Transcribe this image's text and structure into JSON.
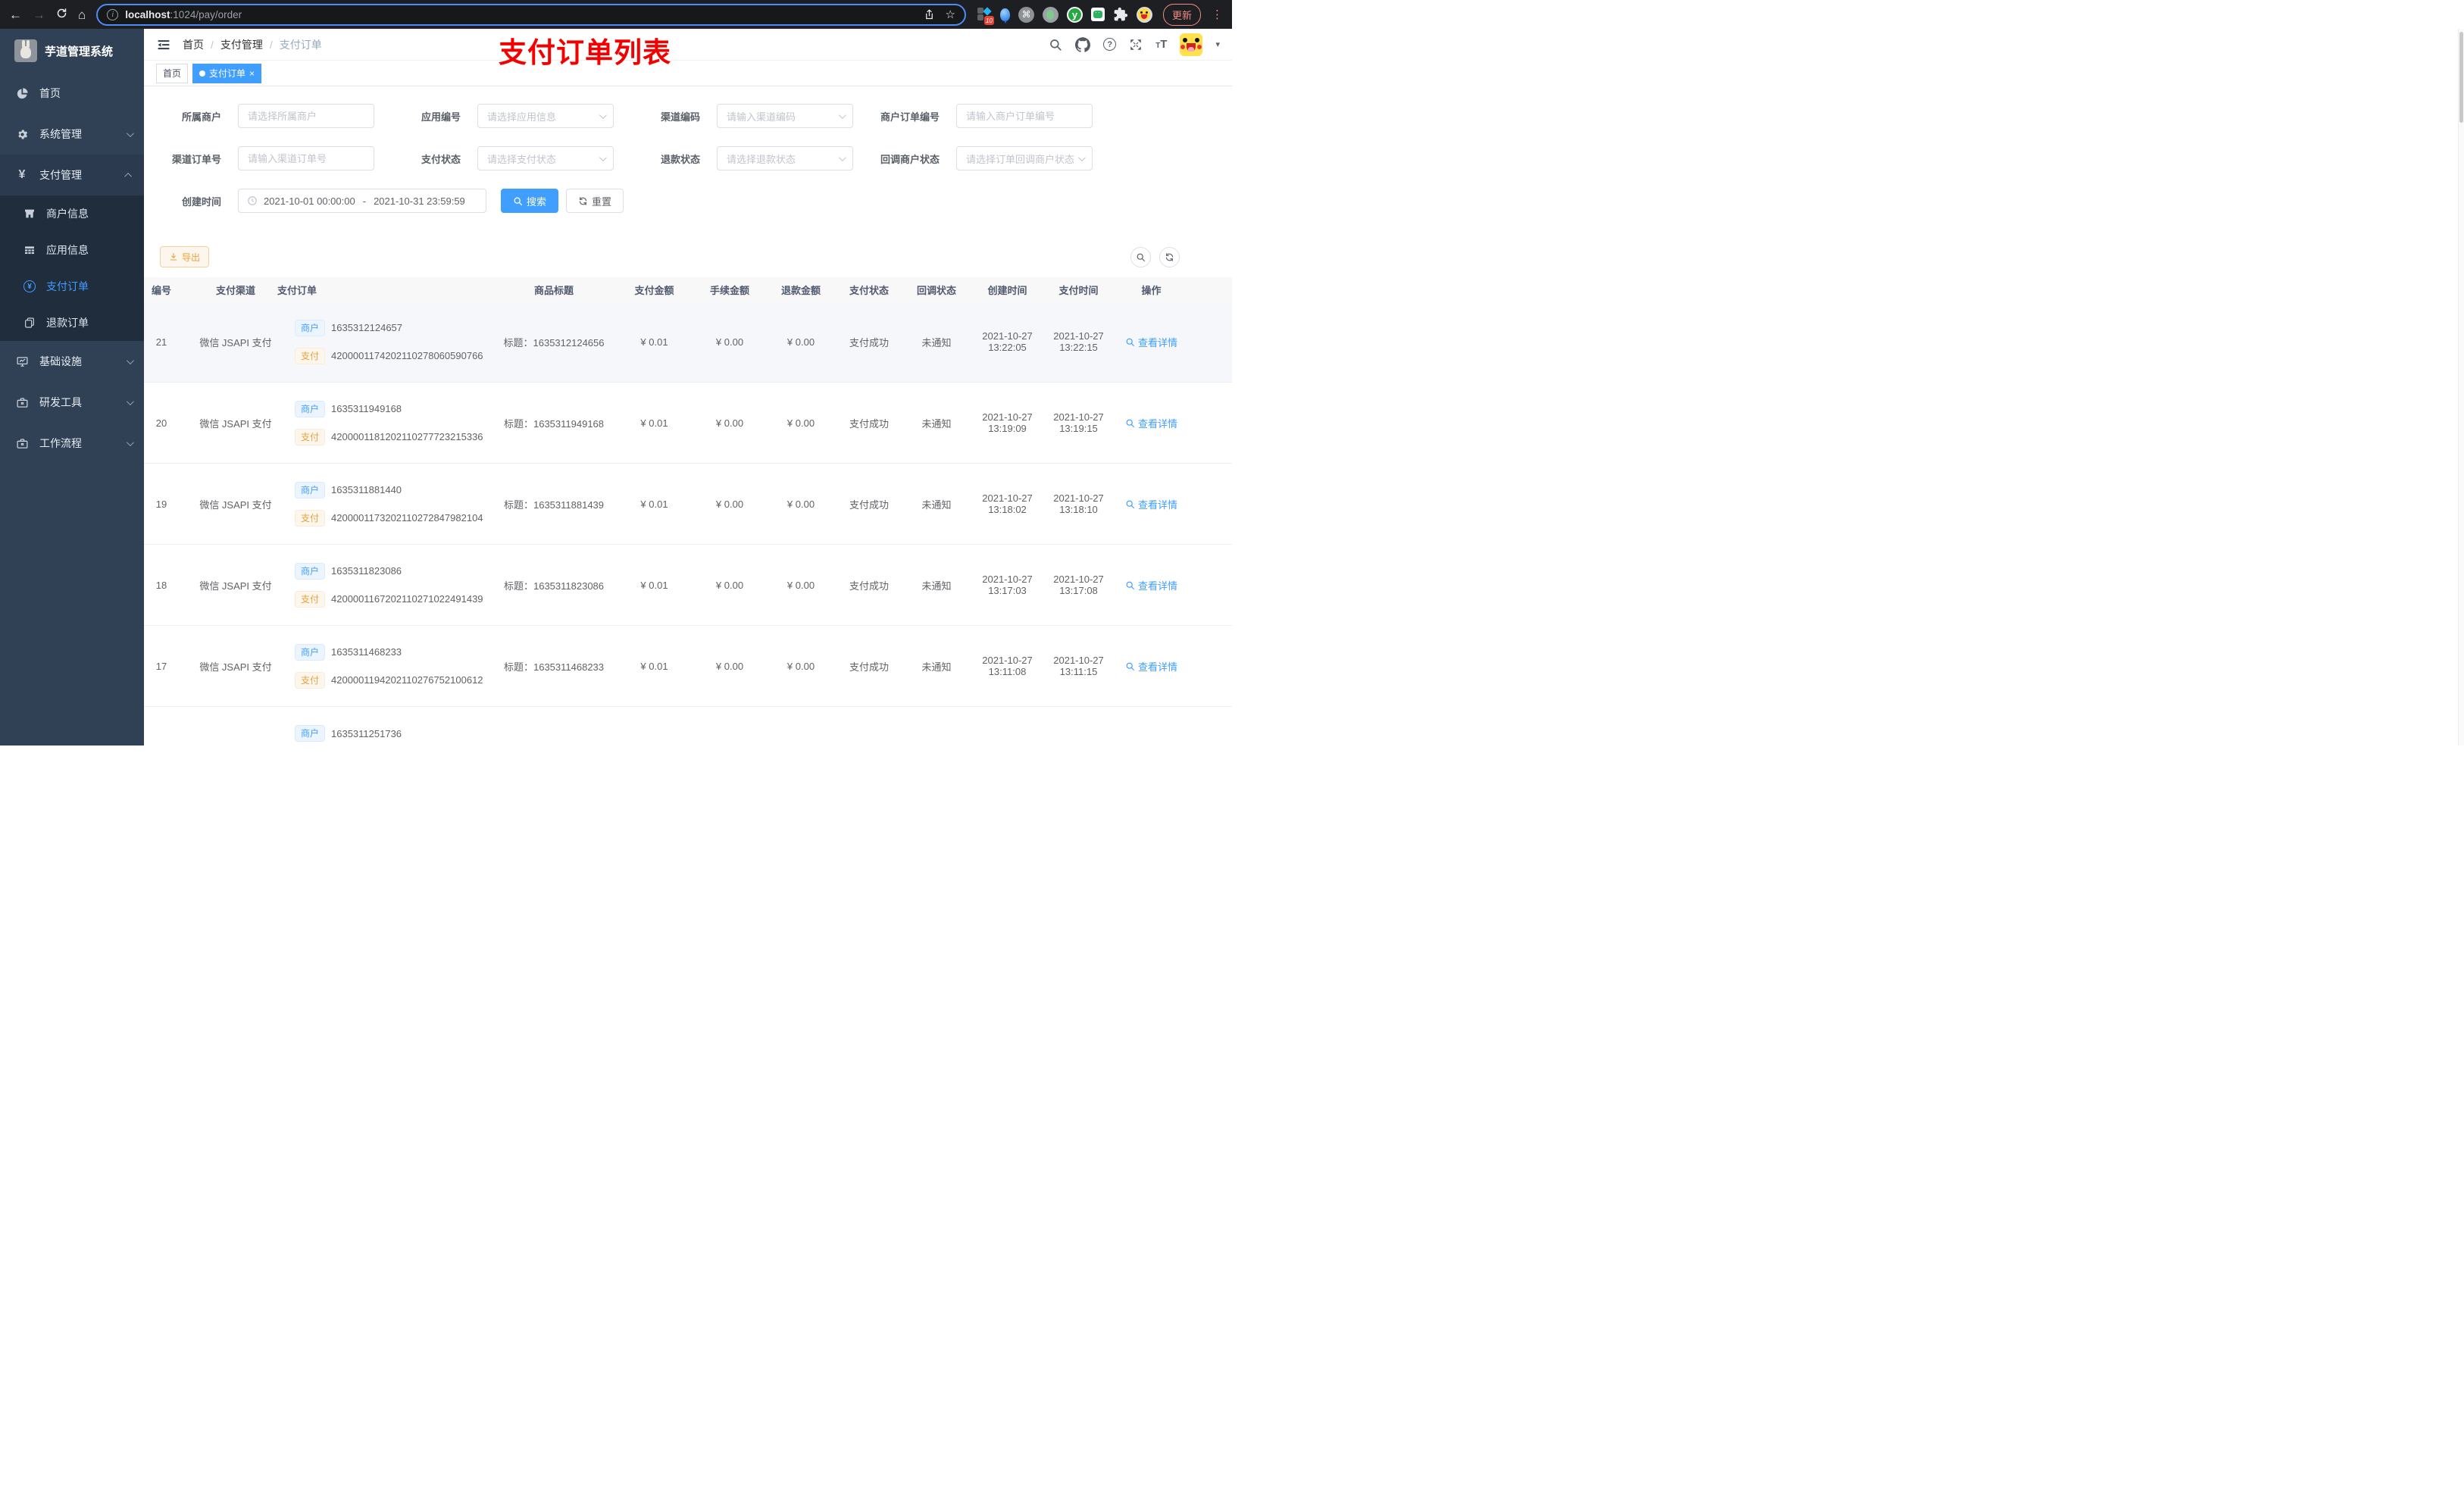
{
  "colors": {
    "accent": "#409eff",
    "sidebar_bg": "#304156",
    "submenu_bg": "#1f2d3d",
    "annotation_red": "#f40000",
    "warning": "#e6a23c",
    "chrome_bg": "#1e1f22"
  },
  "browser": {
    "back": "←",
    "forward": "→",
    "home": "⌂",
    "url_host": "localhost",
    "url_tail": ":1024/pay/order",
    "star": "☆",
    "ext_badge": "10",
    "cmd_glyph": "⌘",
    "y_glyph": "y",
    "update_label": "更新",
    "menu_dots": "⋮",
    "info_glyph": "i"
  },
  "sidebar": {
    "title": "芋道管理系统",
    "yen": "¥",
    "items": [
      {
        "label": "首页"
      },
      {
        "label": "系统管理"
      },
      {
        "label": "支付管理"
      },
      {
        "label": "基础设施"
      },
      {
        "label": "研发工具"
      },
      {
        "label": "工作流程"
      }
    ],
    "submenu": [
      {
        "label": "商户信息"
      },
      {
        "label": "应用信息"
      },
      {
        "label": "支付订单"
      },
      {
        "label": "退款订单"
      }
    ]
  },
  "header": {
    "breadcrumb": [
      "首页",
      "支付管理",
      "支付订单"
    ],
    "separator": "/",
    "annotation": "支付订单列表",
    "question_glyph": "?",
    "font_big": "T",
    "font_small": "T",
    "caret": "▾"
  },
  "tags": {
    "items": [
      {
        "label": "首页"
      },
      {
        "label": "支付订单"
      }
    ],
    "close": "×"
  },
  "filters": {
    "fields": [
      {
        "label": "所属商户",
        "placeholder": "请选择所属商户"
      },
      {
        "label": "应用编号",
        "placeholder": "请选择应用信息"
      },
      {
        "label": "渠道编码",
        "placeholder": "请输入渠道编码"
      },
      {
        "label": "商户订单编号",
        "placeholder": "请输入商户订单编号"
      },
      {
        "label": "渠道订单号",
        "placeholder": "请输入渠道订单号"
      },
      {
        "label": "支付状态",
        "placeholder": "请选择支付状态"
      },
      {
        "label": "退款状态",
        "placeholder": "请选择退款状态"
      },
      {
        "label": "回调商户状态",
        "placeholder": "请选择订单回调商户状态"
      }
    ],
    "date_label": "创建时间",
    "date_start": "2021-10-01 00:00:00",
    "date_sep": "-",
    "date_end": "2021-10-31 23:59:59",
    "search_label": "搜索",
    "reset_label": "重置",
    "export_label": "导出"
  },
  "table": {
    "headers": [
      "编号",
      "支付渠道",
      "支付订单",
      "商品标题",
      "支付金额",
      "手续金额",
      "退款金额",
      "支付状态",
      "回调状态",
      "创建时间",
      "支付时间",
      "操作"
    ],
    "labels": {
      "merchant": "商户",
      "pay": "支付"
    },
    "action_label": "查看详情",
    "rows": [
      {
        "id": "21",
        "channel": "微信 JSAPI 支付",
        "merchant_no": "1635312124657",
        "pay_no": "4200001174202110278060590766",
        "title": "标题：1635312124656",
        "amount": "¥ 0.01",
        "fee": "¥ 0.00",
        "refund": "¥ 0.00",
        "pay_status": "支付成功",
        "notify_status": "未通知",
        "create_date": "2021-10-27",
        "create_time": "13:22:05",
        "pay_date": "2021-10-27",
        "pay_time": "13:22:15"
      },
      {
        "id": "20",
        "channel": "微信 JSAPI 支付",
        "merchant_no": "1635311949168",
        "pay_no": "4200001181202110277723215336",
        "title": "标题：1635311949168",
        "amount": "¥ 0.01",
        "fee": "¥ 0.00",
        "refund": "¥ 0.00",
        "pay_status": "支付成功",
        "notify_status": "未通知",
        "create_date": "2021-10-27",
        "create_time": "13:19:09",
        "pay_date": "2021-10-27",
        "pay_time": "13:19:15"
      },
      {
        "id": "19",
        "channel": "微信 JSAPI 支付",
        "merchant_no": "1635311881440",
        "pay_no": "4200001173202110272847982104",
        "title": "标题：1635311881439",
        "amount": "¥ 0.01",
        "fee": "¥ 0.00",
        "refund": "¥ 0.00",
        "pay_status": "支付成功",
        "notify_status": "未通知",
        "create_date": "2021-10-27",
        "create_time": "13:18:02",
        "pay_date": "2021-10-27",
        "pay_time": "13:18:10"
      },
      {
        "id": "18",
        "channel": "微信 JSAPI 支付",
        "merchant_no": "1635311823086",
        "pay_no": "4200001167202110271022491439",
        "title": "标题：1635311823086",
        "amount": "¥ 0.01",
        "fee": "¥ 0.00",
        "refund": "¥ 0.00",
        "pay_status": "支付成功",
        "notify_status": "未通知",
        "create_date": "2021-10-27",
        "create_time": "13:17:03",
        "pay_date": "2021-10-27",
        "pay_time": "13:17:08"
      },
      {
        "id": "17",
        "channel": "微信 JSAPI 支付",
        "merchant_no": "1635311468233",
        "pay_no": "4200001194202110276752100612",
        "title": "标题：1635311468233",
        "amount": "¥ 0.01",
        "fee": "¥ 0.00",
        "refund": "¥ 0.00",
        "pay_status": "支付成功",
        "notify_status": "未通知",
        "create_date": "2021-10-27",
        "create_time": "13:11:08",
        "pay_date": "2021-10-27",
        "pay_time": "13:11:15"
      }
    ],
    "partial_row": {
      "merchant_no": "1635311251736"
    }
  }
}
